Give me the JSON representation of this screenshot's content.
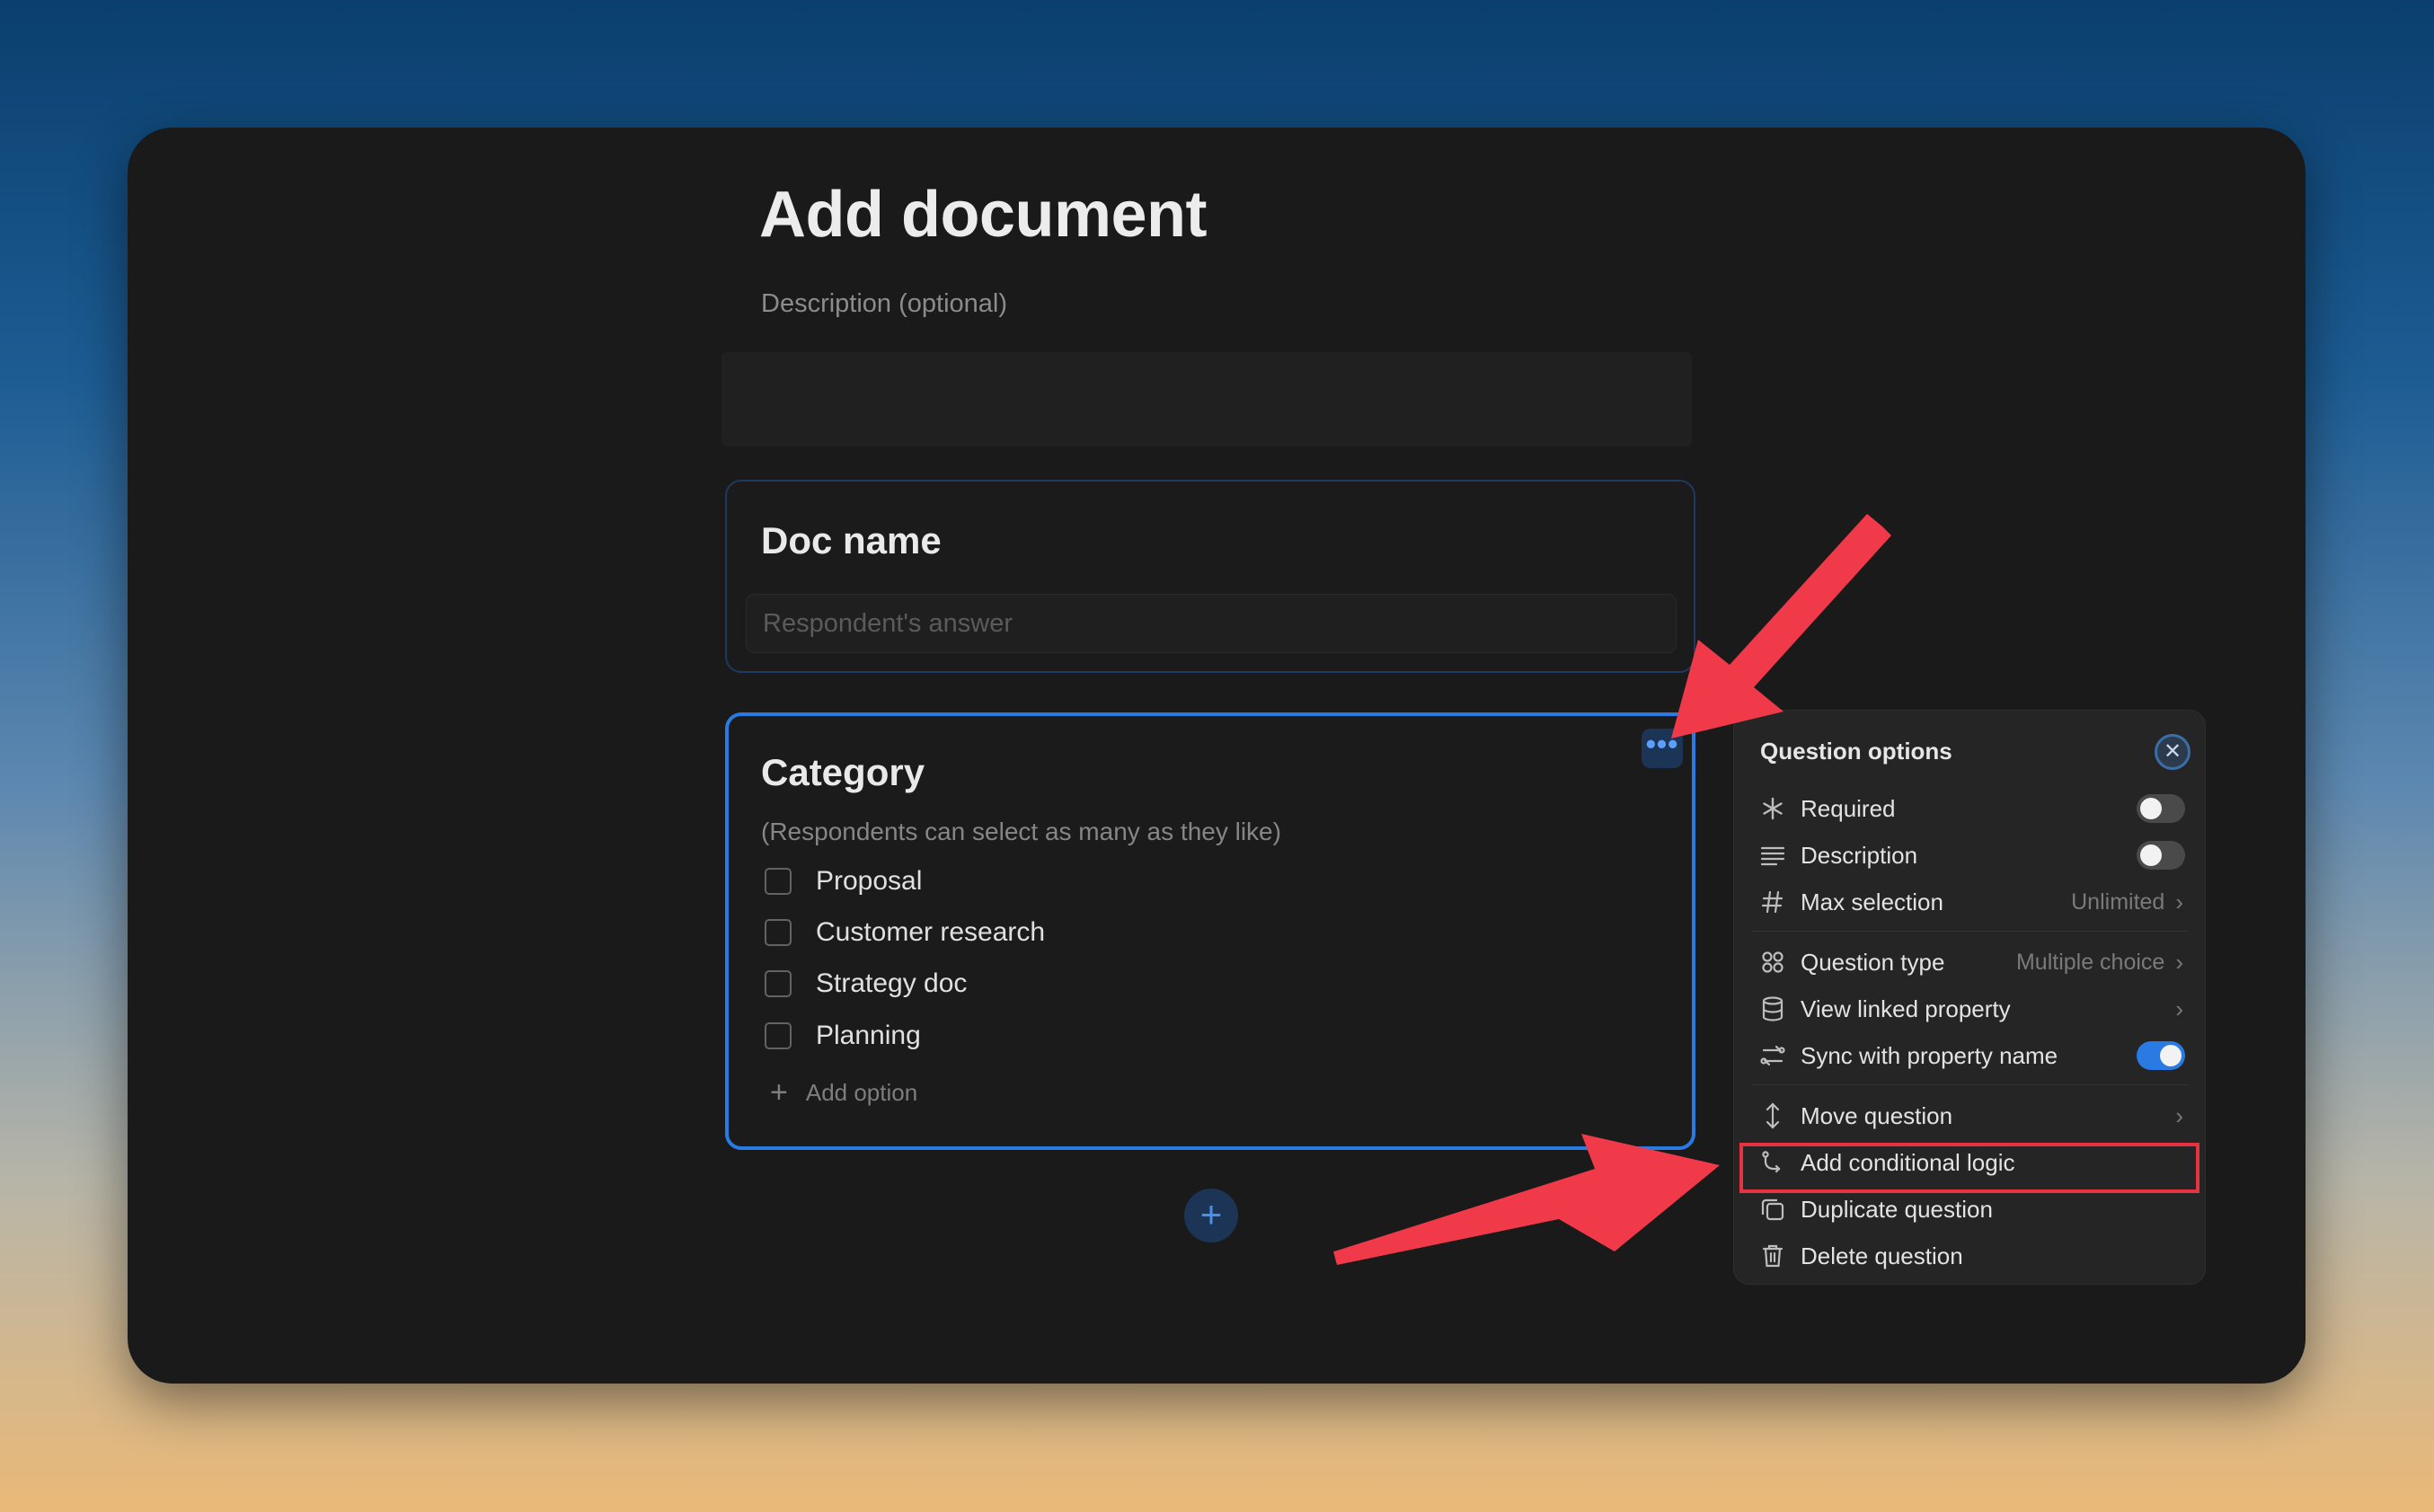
{
  "form": {
    "title": "Add document",
    "description_placeholder": "Description (optional)"
  },
  "doc_name_question": {
    "title": "Doc name",
    "answer_placeholder": "Respondent's answer"
  },
  "category_question": {
    "title": "Category",
    "hint": "(Respondents can select as many as they like)",
    "options": [
      "Proposal",
      "Customer research",
      "Strategy doc",
      "Planning"
    ],
    "add_option_label": "Add option",
    "more_menu_label": "•••"
  },
  "add_question_label": "+",
  "question_options": {
    "title": "Question options",
    "close_label": "✕",
    "items": [
      {
        "label": "Required",
        "icon": "asterisk-icon"
      },
      {
        "label": "Description",
        "icon": "lines-icon"
      },
      {
        "label": "Max selection",
        "value": "Unlimited",
        "icon": "hash-icon"
      },
      {
        "label": "Question type",
        "value": "Multiple choice",
        "icon": "grid-icon"
      },
      {
        "label": "View linked property",
        "icon": "database-icon"
      },
      {
        "label": "Sync with property name",
        "icon": "sync-icon"
      },
      {
        "label": "Move question",
        "icon": "move-icon"
      },
      {
        "label": "Add conditional logic",
        "icon": "branch-icon"
      },
      {
        "label": "Duplicate question",
        "icon": "duplicate-icon"
      },
      {
        "label": "Delete question",
        "icon": "trash-icon"
      }
    ],
    "toggles": {
      "required": false,
      "description": false,
      "sync_with_property_name": true
    }
  },
  "colors": {
    "accent": "#2a7ae4",
    "annotation": "#f03a4a",
    "panel_bg": "#252525",
    "window_bg": "#1a1a1a"
  }
}
